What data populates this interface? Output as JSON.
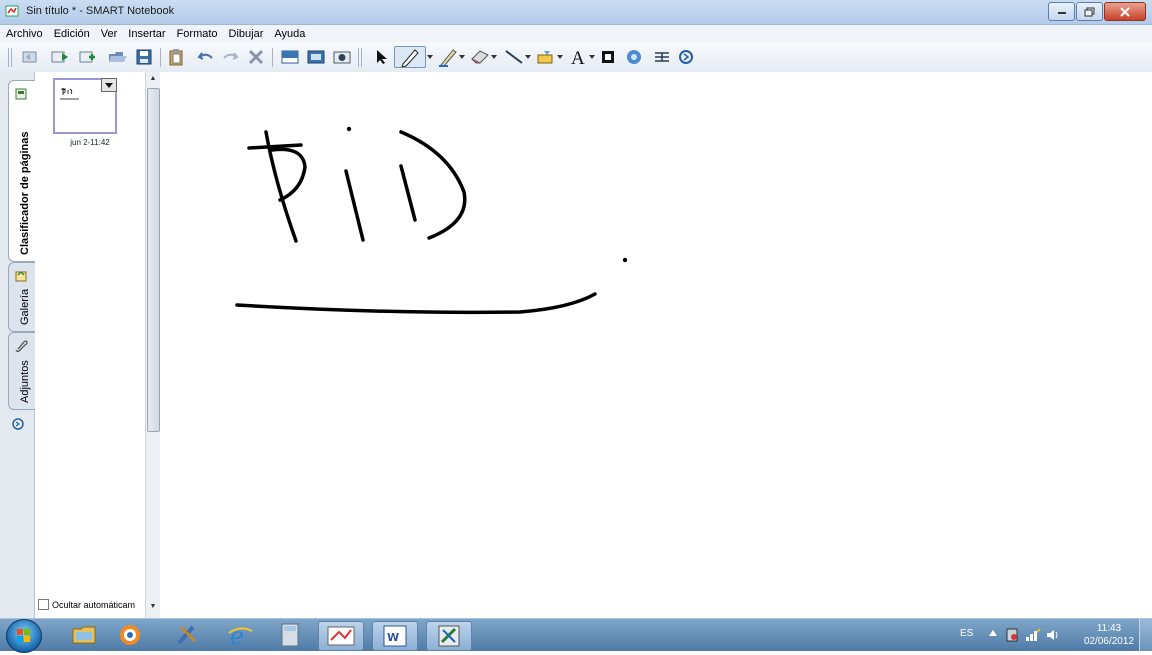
{
  "window": {
    "title": "Sin título * - SMART Notebook"
  },
  "menu": [
    "Archivo",
    "Edición",
    "Ver",
    "Insertar",
    "Formato",
    "Dibujar",
    "Ayuda"
  ],
  "toolbar": {
    "icons": [
      "previous-page",
      "next-page",
      "add-page",
      "open",
      "save",
      "paste",
      "undo",
      "redo",
      "delete",
      "screen-shade",
      "full-screen",
      "capture",
      "select",
      "pen",
      "creative-pen",
      "eraser",
      "line",
      "shape",
      "text",
      "fill",
      "properties",
      "table",
      "more"
    ]
  },
  "side_tabs": {
    "page_sorter": "Clasificador de páginas",
    "gallery": "Galería",
    "attachments": "Adjuntos"
  },
  "page_sorter": {
    "thumbnail_label": "jun 2-11:42",
    "autohide_label": "Ocultar automáticam"
  },
  "taskbar": {
    "language": "ES",
    "time": "11:43",
    "date": "02/06/2012"
  },
  "colors": {
    "ink": "#000000",
    "selection_border": "#9b97d8",
    "taskbar": "#4f7ba7"
  }
}
